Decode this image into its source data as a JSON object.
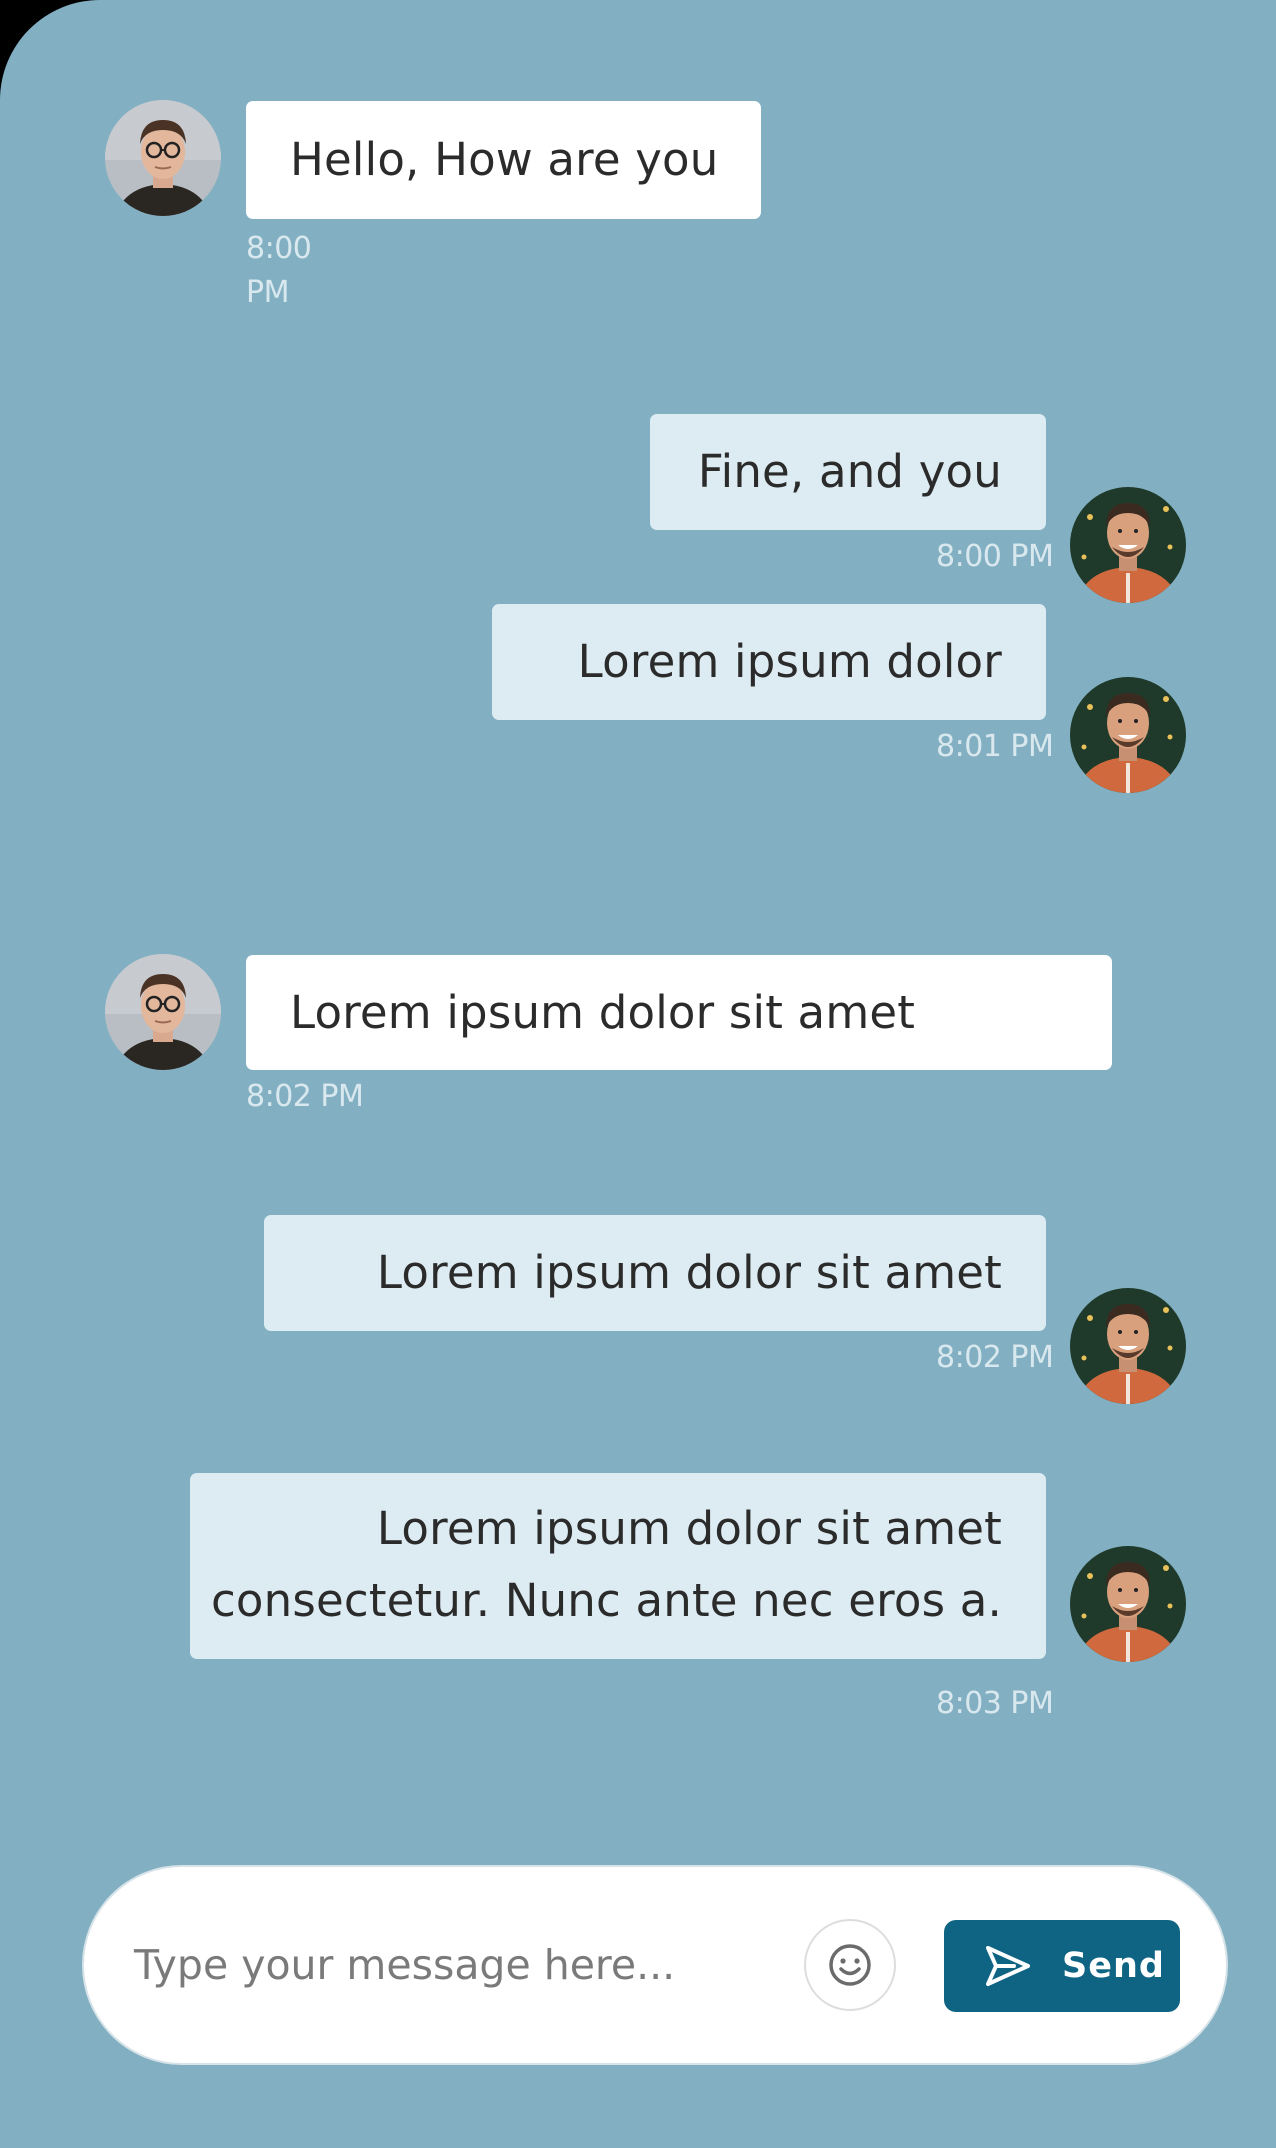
{
  "messages": [
    {
      "side": "in",
      "text": "Hello, How are you",
      "time": "8:00\nPM"
    },
    {
      "side": "out",
      "text": "Fine, and you",
      "time": "8:00 PM"
    },
    {
      "side": "out",
      "text": "Lorem ipsum dolor",
      "time": "8:01 PM"
    },
    {
      "side": "in",
      "text": "Lorem ipsum dolor sit amet",
      "time": "8:02 PM"
    },
    {
      "side": "out",
      "text": "Lorem ipsum dolor sit amet",
      "time": "8:02 PM"
    },
    {
      "side": "out",
      "text_line1": "Lorem ipsum dolor sit amet",
      "text_line2": "consectetur. Nunc ante nec eros a.",
      "time": "8:03 PM"
    }
  ],
  "time_first_line1": "8:00",
  "time_first_line2": "PM",
  "composer": {
    "placeholder": "Type your message here...",
    "emoji_icon": "smiley-icon",
    "send_icon": "send-arrow-icon",
    "send_label": "Send"
  },
  "colors": {
    "background": "#82b0c2",
    "incoming_bubble": "#ffffff",
    "outgoing_bubble": "#ddecf2",
    "send_button": "#0f6484",
    "timestamp": "#d9e8ee"
  }
}
